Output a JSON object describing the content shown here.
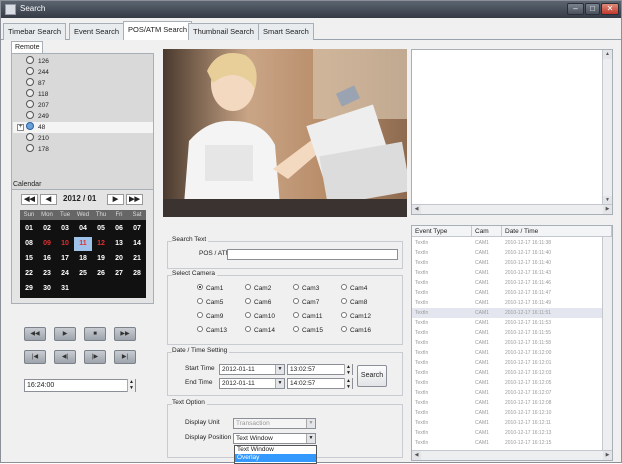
{
  "window": {
    "title": "Search"
  },
  "tabs": [
    "Timebar Search",
    "Event Search",
    "POS/ATM Search",
    "Thumbnail Search",
    "Smart Search"
  ],
  "active_tab": 2,
  "remote": {
    "tab_label": "Remote",
    "items": [
      "126",
      "244",
      "87",
      "118",
      "207",
      "249",
      "48",
      "210",
      "178"
    ],
    "selected_index": 6
  },
  "calendar": {
    "label": "Calendar",
    "month": "2012 / 01",
    "nav": [
      "◀◀",
      "◀",
      "▶",
      "▶▶"
    ],
    "weekdays": [
      "Sun",
      "Mon",
      "Tue",
      "Wed",
      "Thu",
      "Fri",
      "Sat"
    ],
    "weeks": [
      [
        "01",
        "02",
        "03",
        "04",
        "05",
        "06",
        "07"
      ],
      [
        "08",
        "09",
        "10",
        "11",
        "12",
        "13",
        "14"
      ],
      [
        "15",
        "16",
        "17",
        "18",
        "19",
        "20",
        "21"
      ],
      [
        "22",
        "23",
        "24",
        "25",
        "26",
        "27",
        "28"
      ],
      [
        "29",
        "30",
        "31",
        "",
        "",
        "",
        ""
      ]
    ],
    "red_days": [
      "09",
      "10",
      "12"
    ],
    "today": "11"
  },
  "playback": {
    "row1": [
      "◀◀",
      "▶",
      "■",
      "▶▶"
    ],
    "row2": [
      "|◀",
      "◀|",
      "|▶",
      "▶|"
    ]
  },
  "time_value": "16:24:00",
  "search_text": {
    "group_label": "Search Text",
    "pos_label": "POS / ATM",
    "pos_value": ""
  },
  "select_camera": {
    "group_label": "Select Camera",
    "cameras": [
      "Cam1",
      "Cam2",
      "Cam3",
      "Cam4",
      "Cam5",
      "Cam6",
      "Cam7",
      "Cam8",
      "Cam9",
      "Cam10",
      "Cam11",
      "Cam12",
      "Cam13",
      "Cam14",
      "Cam15",
      "Cam16"
    ],
    "selected": "Cam1"
  },
  "datetime": {
    "group_label": "Date / Time Setting",
    "start_label": "Start Time",
    "start_date": "2012-01-11",
    "start_time": "13:02:57",
    "end_label": "End Time",
    "end_date": "2012-01-11",
    "end_time": "14:02:57",
    "search_button": "Search"
  },
  "text_option": {
    "group_label": "Text Option",
    "display_unit_label": "Display Unit",
    "display_unit_value": "Transaction",
    "display_position_label": "Display Position",
    "display_position_value": "Text Window",
    "dropdown_options": [
      "Text Window",
      "Overlay"
    ],
    "highlighted_option": 1
  },
  "event_table": {
    "columns": [
      "Event Type",
      "Cam",
      "Date / Time"
    ],
    "rows": [
      [
        "TextIn",
        "CAM1",
        "2010-12-17 16:11:38"
      ],
      [
        "TextIn",
        "CAM1",
        "2010-12-17 16:11:40"
      ],
      [
        "TextIn",
        "CAM1",
        "2010-12-17 16:11:40"
      ],
      [
        "TextIn",
        "CAM1",
        "2010-12-17 16:11:43"
      ],
      [
        "TextIn",
        "CAM1",
        "2010-12-17 16:11:46"
      ],
      [
        "TextIn",
        "CAM1",
        "2010-12-17 16:11:47"
      ],
      [
        "TextIn",
        "CAM1",
        "2010-12-17 16:11:49"
      ],
      [
        "TextIn",
        "CAM1",
        "2010-12-17 16:11:51"
      ],
      [
        "TextIn",
        "CAM1",
        "2010-12-17 16:11:53"
      ],
      [
        "TextIn",
        "CAM1",
        "2010-12-17 16:11:55"
      ],
      [
        "TextIn",
        "CAM1",
        "2010-12-17 16:11:58"
      ],
      [
        "TextIn",
        "CAM1",
        "2010-12-17 16:12:00"
      ],
      [
        "TextIn",
        "CAM1",
        "2010-12-17 16:12:01"
      ],
      [
        "TextIn",
        "CAM1",
        "2010-12-17 16:12:03"
      ],
      [
        "TextIn",
        "CAM1",
        "2010-12-17 16:12:05"
      ],
      [
        "TextIn",
        "CAM1",
        "2010-12-17 16:12:07"
      ],
      [
        "TextIn",
        "CAM1",
        "2010-12-17 16:12:08"
      ],
      [
        "TextIn",
        "CAM1",
        "2010-12-17 16:12:10"
      ],
      [
        "TextIn",
        "CAM1",
        "2010-12-17 16:12:11"
      ],
      [
        "TextIn",
        "CAM1",
        "2010-12-17 16:12:13"
      ],
      [
        "TextIn",
        "CAM1",
        "2010-12-17 16:12:15"
      ],
      [
        "TextIn",
        "CAM1",
        "2010-12-17 16:12:16"
      ]
    ],
    "selected_row": 7
  },
  "colors": {
    "calendar_bg": "#111111",
    "calendar_red": "#e03030",
    "calendar_today": "#9fc2ea",
    "dropdown_highlight": "#3399ff"
  }
}
